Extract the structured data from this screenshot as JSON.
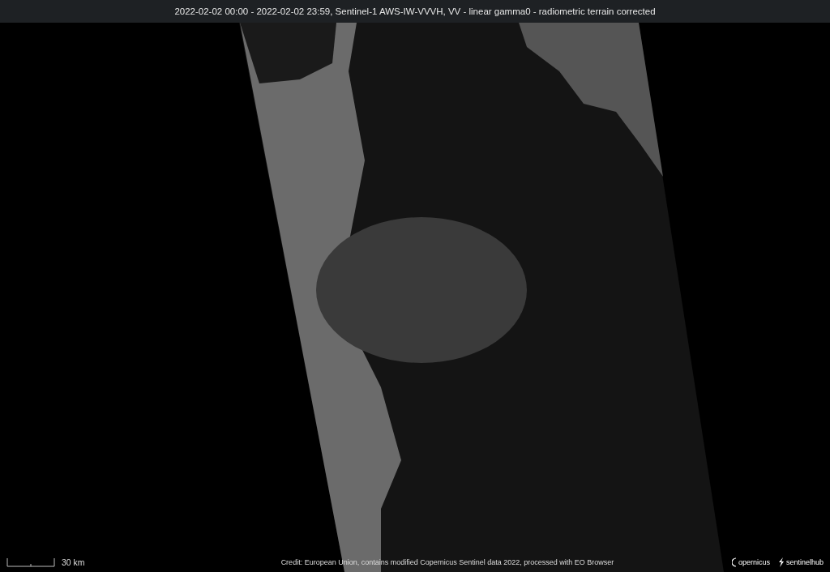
{
  "title": "2022-02-02 00:00 - 2022-02-02 23:59, Sentinel-1 AWS-IW-VVVH, VV - linear gamma0 - radiometric terrain corrected",
  "scale": {
    "label": "30 km"
  },
  "credit": "Credit: European Union, contains modified Copernicus Sentinel data 2022, processed with EO Browser",
  "logos": [
    {
      "kind": "copernicus",
      "text": "opernicus"
    },
    {
      "kind": "sentinelhub",
      "text": "sentinelhub"
    }
  ]
}
